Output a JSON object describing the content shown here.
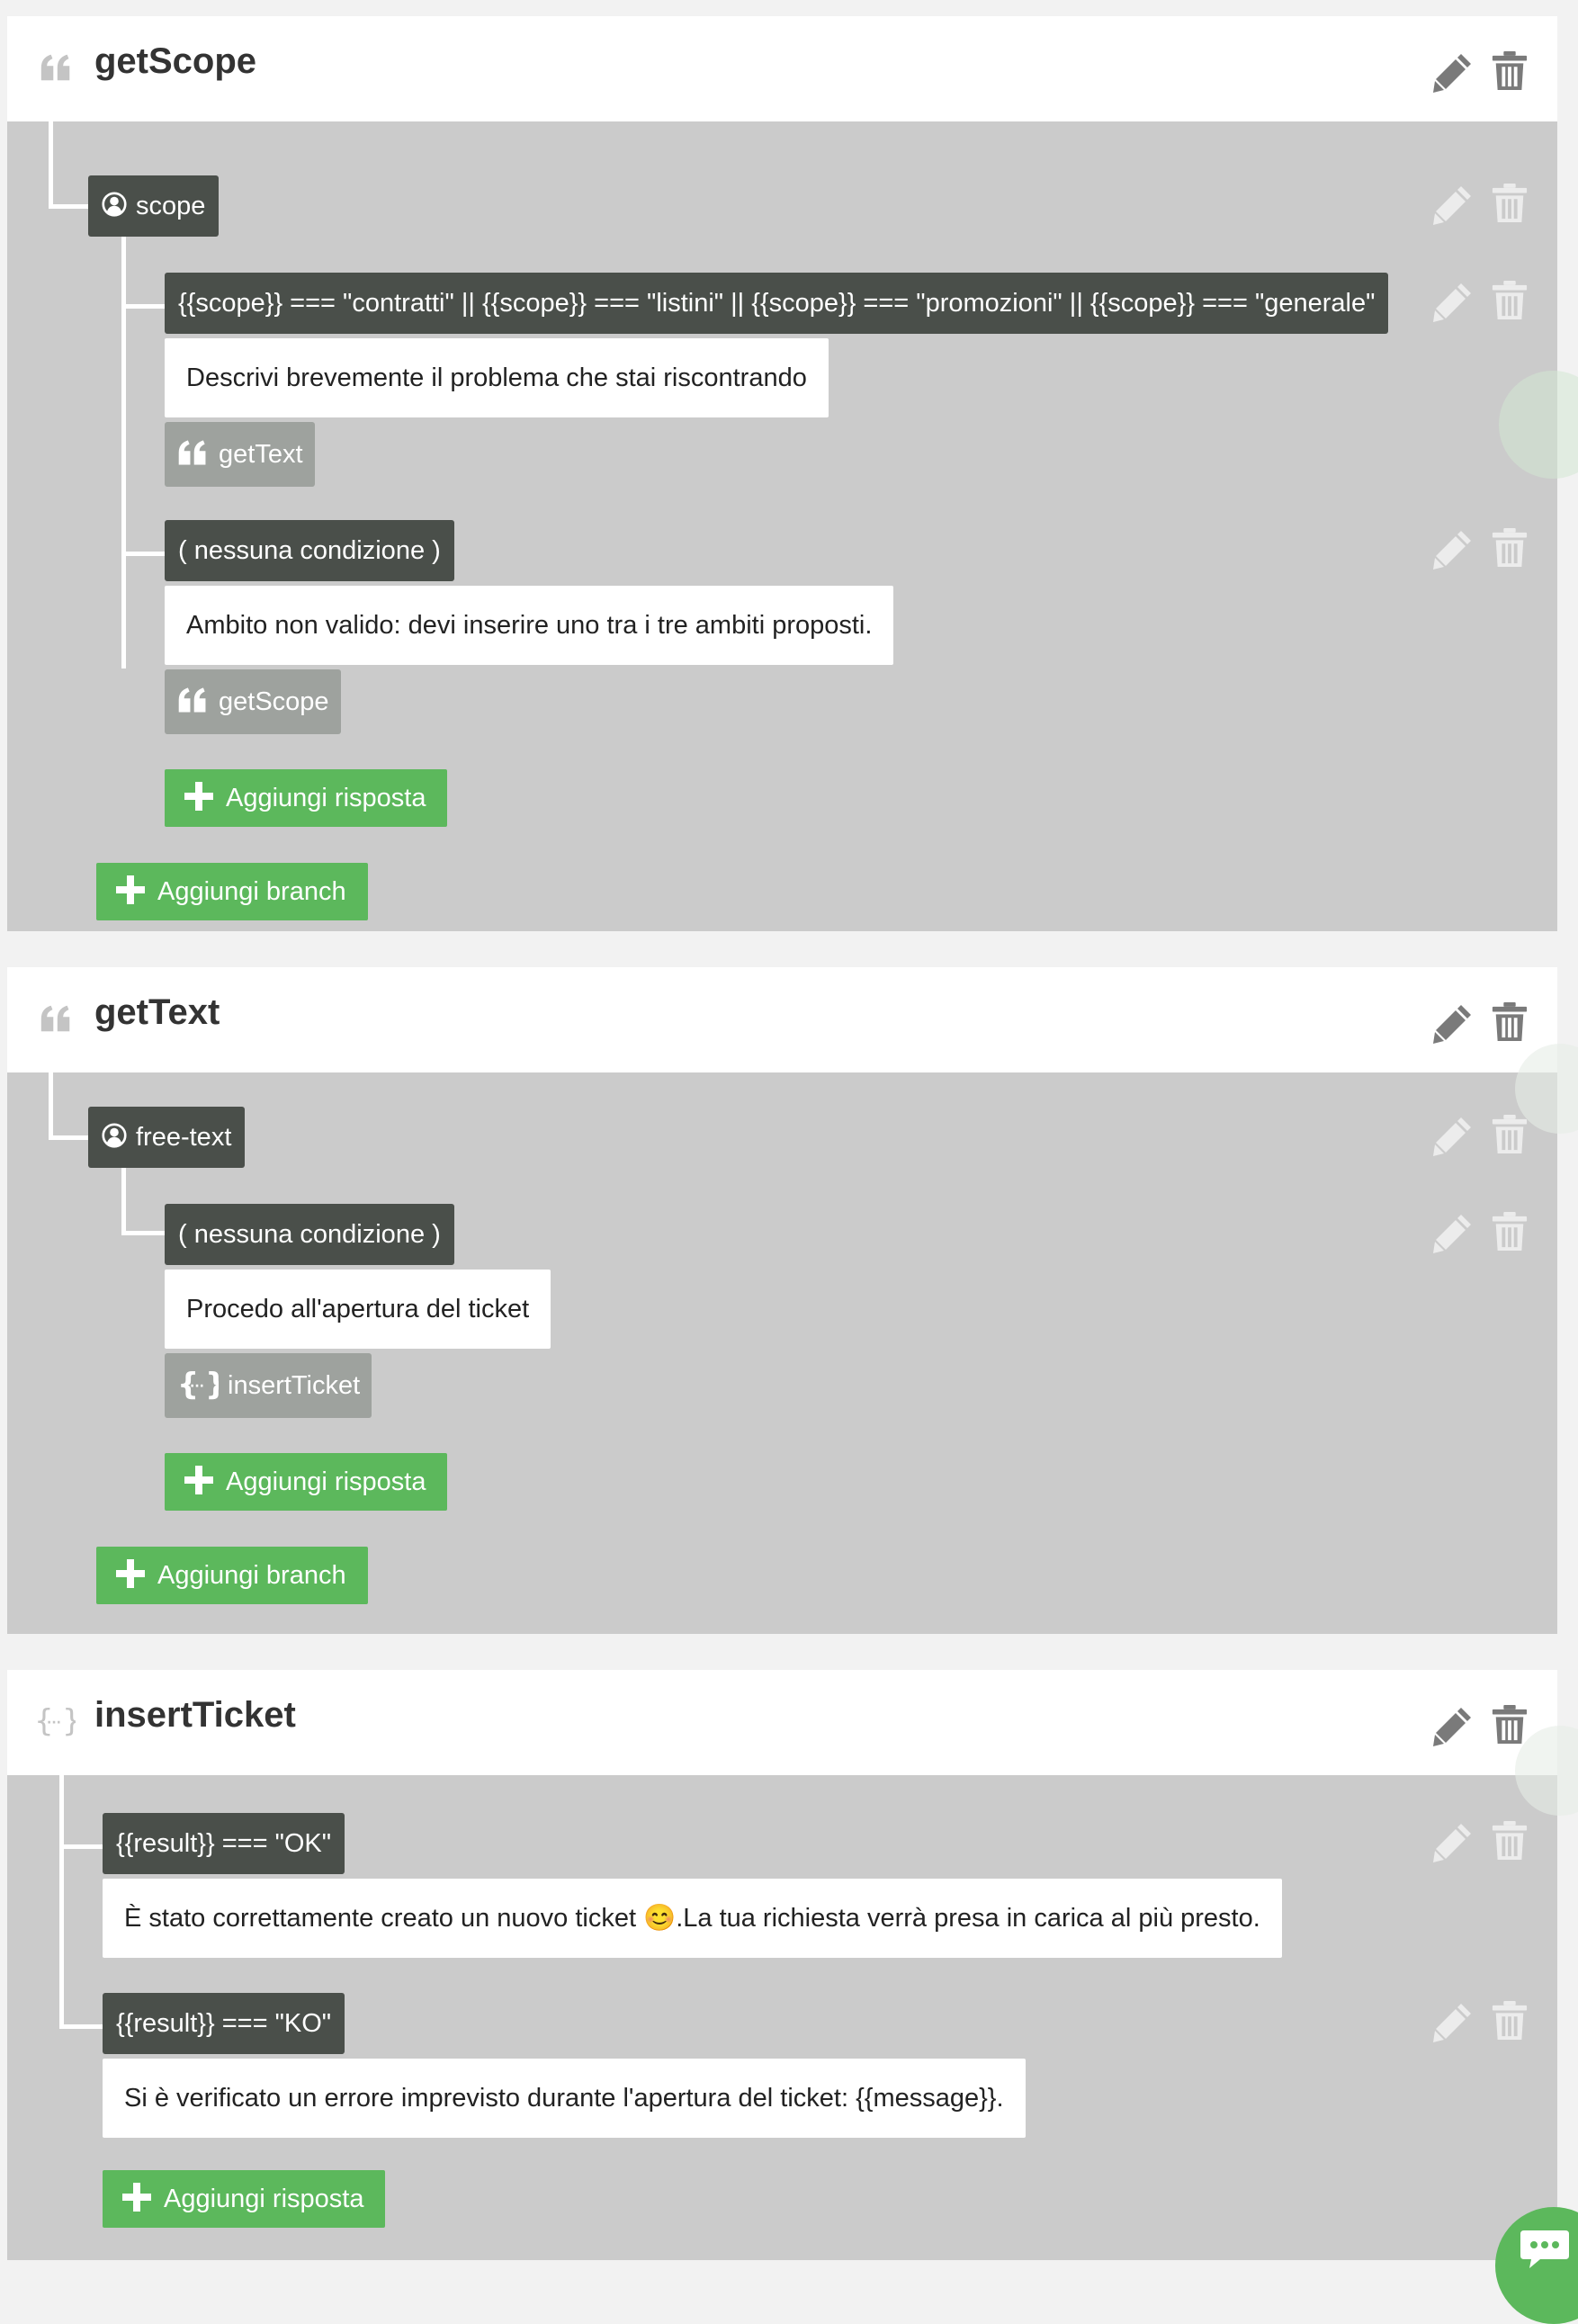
{
  "theme": {
    "accent_green": "#5cb85c",
    "tag_dark": "#4a4f4a",
    "panel_gray": "#cbcbcb",
    "next_gray": "#9ea29e",
    "action_icon_dark": "#7a7a7a",
    "action_icon_light": "#ececec"
  },
  "icons": {
    "block_quote": "quote-icon",
    "block_braces": "braces-icon",
    "edit": "pencil-icon",
    "delete": "trash-icon",
    "input": "user-circle-icon",
    "add": "plus-icon",
    "chat": "chat-bubble-icon"
  },
  "blocks": [
    {
      "title": "getScope",
      "type_icon": "quote-icon",
      "input": {
        "label": "scope"
      },
      "branches": [
        {
          "condition": "{{scope}} === \"contratti\" || {{scope}} === \"listini\" || {{scope}} === \"promozioni\" || {{scope}} === \"generale\"",
          "message": "Descrivi brevemente il problema che stai riscontrando",
          "next": {
            "icon": "quote-icon",
            "label": "getText"
          }
        },
        {
          "condition": "( nessuna condizione )",
          "message": "Ambito non valido: devi inserire uno tra i tre ambiti proposti.",
          "next": {
            "icon": "quote-icon",
            "label": "getScope"
          }
        }
      ],
      "add_response": "Aggiungi risposta",
      "add_branch": "Aggiungi branch"
    },
    {
      "title": "getText",
      "type_icon": "quote-icon",
      "input": {
        "label": "free-text"
      },
      "branches": [
        {
          "condition": "( nessuna condizione )",
          "message": "Procedo all'apertura del ticket",
          "next": {
            "icon": "braces-icon",
            "label": "insertTicket"
          }
        }
      ],
      "add_response": "Aggiungi risposta",
      "add_branch": "Aggiungi branch"
    },
    {
      "title": "insertTicket",
      "type_icon": "braces-icon",
      "branches": [
        {
          "condition": "{{result}} === \"OK\"",
          "message": "È stato correttamente creato un nuovo ticket 😊.La tua richiesta verrà presa in carica al più presto."
        },
        {
          "condition": "{{result}} === \"KO\"",
          "message": "Si è verificato un errore imprevisto durante l'apertura del ticket: {{message}}."
        }
      ],
      "add_response": "Aggiungi risposta"
    }
  ]
}
